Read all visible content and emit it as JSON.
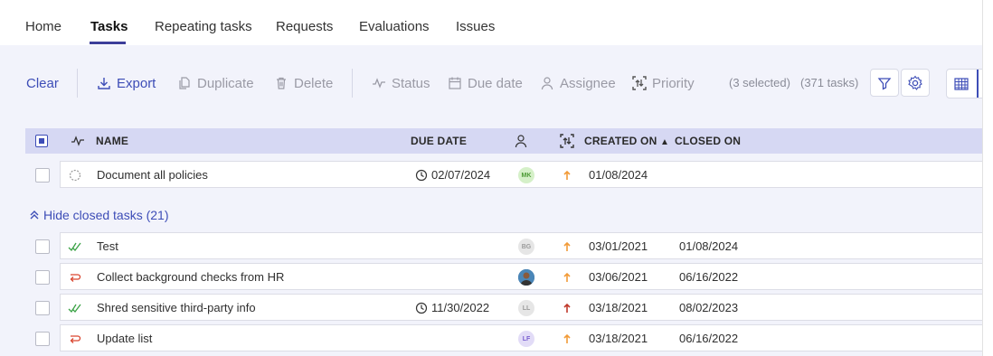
{
  "nav": {
    "tabs": [
      "Home",
      "Tasks",
      "Repeating tasks",
      "Requests",
      "Evaluations",
      "Issues"
    ],
    "active": "Tasks"
  },
  "toolbar": {
    "clear": "Clear",
    "export": "Export",
    "duplicate": "Duplicate",
    "delete": "Delete",
    "status": "Status",
    "due_date": "Due date",
    "assignee": "Assignee",
    "priority": "Priority",
    "selected": "(3 selected)",
    "total": "(371 tasks)"
  },
  "table": {
    "headers": {
      "name": "NAME",
      "due_date": "DUE DATE",
      "created_on": "CREATED ON",
      "closed_on": "CLOSED ON"
    },
    "sort_indicator": "▲",
    "open_rows": [
      {
        "name": "Document all policies",
        "due": "02/07/2024",
        "assignee": "MK",
        "created": "01/08/2024",
        "closed": "",
        "status": "open-icon",
        "priority": "medium"
      }
    ],
    "group_label": "Hide closed tasks (21)",
    "closed_rows": [
      {
        "name": "Test",
        "due": "",
        "assignee": "BG",
        "created": "03/01/2021",
        "closed": "01/08/2024",
        "status": "check-icon",
        "priority": "medium"
      },
      {
        "name": "Collect background checks from HR",
        "due": "",
        "assignee": "photo",
        "created": "03/06/2021",
        "closed": "06/16/2022",
        "status": "returned-icon",
        "priority": "medium"
      },
      {
        "name": "Shred sensitive third-party info",
        "due": "11/30/2022",
        "assignee": "LL",
        "created": "03/18/2021",
        "closed": "08/02/2023",
        "status": "check-icon",
        "priority": "high"
      },
      {
        "name": "Update list",
        "due": "",
        "assignee": "LF",
        "created": "03/18/2021",
        "closed": "06/16/2022",
        "status": "returned-icon",
        "priority": "medium"
      }
    ]
  },
  "colors": {
    "accent": "#3d4db7",
    "header_bg": "#d6d8f3",
    "content_bg": "#f2f3fb",
    "priority_medium": "#f29b38",
    "priority_high": "#c0392b",
    "done": "#3aa245",
    "returned": "#d9452f"
  }
}
